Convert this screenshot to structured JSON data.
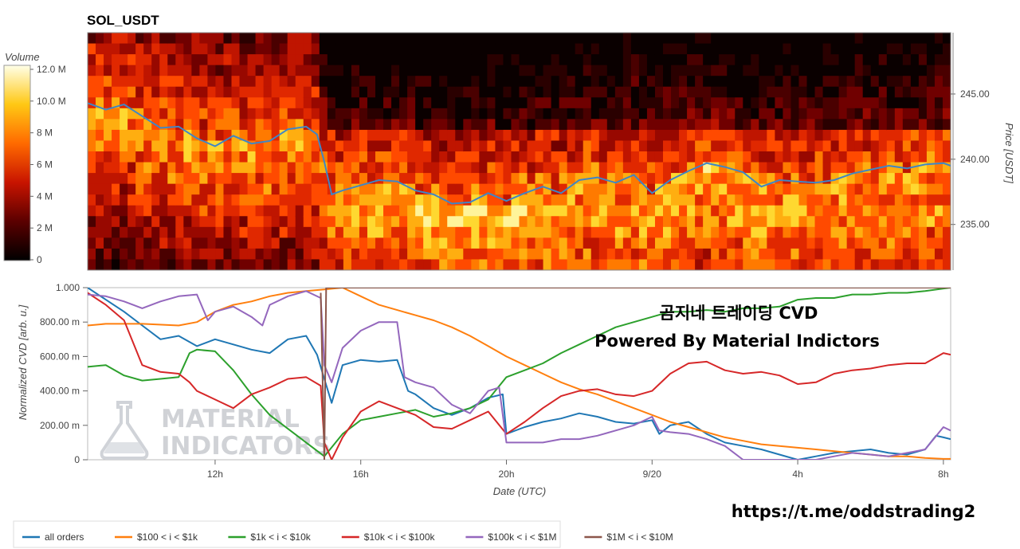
{
  "chart_data": [
    {
      "type": "heatmap",
      "title": "SOL_USDT",
      "colorbar": {
        "label": "Volume",
        "ticks": [
          "0",
          "2 M",
          "4 M",
          "6 M",
          "8 M",
          "10.0 M",
          "12.0 M"
        ],
        "range": [
          0,
          12000000
        ]
      },
      "x_range_hours": [
        8.5,
        32.2
      ],
      "ylabel": "Price [USDT]",
      "y_ticks": [
        "235.00",
        "240.00",
        "245.00"
      ],
      "ylim": [
        231.5,
        249.7
      ],
      "price_line": {
        "x_hours": [
          8.5,
          9.0,
          9.5,
          10.0,
          10.5,
          11.0,
          11.5,
          12.0,
          12.5,
          13.0,
          13.5,
          14.0,
          14.5,
          14.8,
          15.0,
          15.2,
          15.5,
          16.0,
          16.5,
          17.0,
          17.5,
          18.0,
          18.5,
          19.0,
          19.5,
          20.0,
          20.5,
          21.0,
          21.5,
          22.0,
          22.5,
          23.0,
          23.5,
          24.0,
          24.5,
          25.0,
          25.5,
          26.0,
          26.5,
          27.0,
          27.5,
          28.0,
          28.5,
          29.0,
          29.5,
          30.0,
          30.5,
          31.0,
          31.5,
          32.0,
          32.2
        ],
        "price": [
          244.3,
          243.8,
          244.2,
          243.3,
          242.4,
          242.5,
          241.6,
          241.0,
          241.8,
          241.2,
          241.4,
          242.3,
          242.5,
          241.9,
          239.8,
          237.3,
          237.6,
          238.0,
          238.4,
          238.3,
          237.6,
          237.3,
          236.6,
          236.7,
          237.4,
          236.8,
          237.4,
          237.9,
          237.4,
          238.4,
          238.6,
          238.2,
          238.8,
          237.4,
          238.4,
          239.1,
          239.7,
          239.4,
          239.0,
          237.9,
          238.4,
          238.3,
          238.2,
          238.4,
          238.9,
          239.2,
          239.5,
          239.3,
          239.6,
          239.7,
          239.5
        ]
      }
    },
    {
      "type": "line",
      "xlabel": "Date (UTC)",
      "ylabel": "Normalized CVD [arb. u.]",
      "x_ticks": [
        "12h",
        "16h",
        "20h",
        "9/20",
        "4h",
        "8h"
      ],
      "x_tick_hours": [
        12,
        16,
        20,
        24,
        28,
        32
      ],
      "x_range_hours": [
        8.5,
        32.2
      ],
      "y_ticks": [
        "0",
        "200.00 m",
        "400.00 m",
        "600.00 m",
        "800.00 m",
        "1.000"
      ],
      "ylim": [
        0,
        1
      ],
      "series": [
        {
          "name": "all orders",
          "color": "#1f77b4",
          "x": [
            8.5,
            9.0,
            9.5,
            10.0,
            10.5,
            11.0,
            11.5,
            12.0,
            12.5,
            13.0,
            13.5,
            14.0,
            14.5,
            14.8,
            15.0,
            15.2,
            15.5,
            16.0,
            16.5,
            17.0,
            17.3,
            17.5,
            18.0,
            18.5,
            19.0,
            19.5,
            19.9,
            20.0,
            20.5,
            21.0,
            21.5,
            22.0,
            22.5,
            23.0,
            23.5,
            24.0,
            24.2,
            24.5,
            25.0,
            25.5,
            26.0,
            26.5,
            27.0,
            27.5,
            28.0,
            28.5,
            29.0,
            29.5,
            30.0,
            30.5,
            31.0,
            31.5,
            31.8,
            32.0,
            32.2
          ],
          "y": [
            1.0,
            0.93,
            0.86,
            0.78,
            0.7,
            0.72,
            0.66,
            0.7,
            0.67,
            0.64,
            0.62,
            0.7,
            0.72,
            0.61,
            0.47,
            0.33,
            0.55,
            0.58,
            0.57,
            0.58,
            0.4,
            0.38,
            0.3,
            0.26,
            0.3,
            0.36,
            0.38,
            0.15,
            0.19,
            0.22,
            0.24,
            0.27,
            0.25,
            0.22,
            0.21,
            0.23,
            0.15,
            0.2,
            0.22,
            0.15,
            0.1,
            0.08,
            0.06,
            0.03,
            0.0,
            0.02,
            0.04,
            0.05,
            0.06,
            0.04,
            0.03,
            0.06,
            0.14,
            0.13,
            0.12
          ]
        },
        {
          "name": "$100 < i < $1k",
          "color": "#ff7f0e",
          "x": [
            8.5,
            9.0,
            10.0,
            11.0,
            11.5,
            12.0,
            12.5,
            13.0,
            13.5,
            14.0,
            14.5,
            15.0,
            15.5,
            16.0,
            16.5,
            17.0,
            17.5,
            18.0,
            18.5,
            19.0,
            19.5,
            20.0,
            20.5,
            21.0,
            21.5,
            22.0,
            22.5,
            23.0,
            23.5,
            24.0,
            24.5,
            25.0,
            25.5,
            26.0,
            26.5,
            27.0,
            27.5,
            28.0,
            28.5,
            29.0,
            29.5,
            30.0,
            30.5,
            31.0,
            31.5,
            32.0,
            32.2
          ],
          "y": [
            0.78,
            0.79,
            0.79,
            0.78,
            0.8,
            0.86,
            0.9,
            0.92,
            0.95,
            0.97,
            0.98,
            0.99,
            1.0,
            0.95,
            0.9,
            0.87,
            0.84,
            0.81,
            0.77,
            0.72,
            0.66,
            0.6,
            0.55,
            0.5,
            0.45,
            0.41,
            0.38,
            0.34,
            0.3,
            0.26,
            0.22,
            0.19,
            0.16,
            0.13,
            0.11,
            0.09,
            0.08,
            0.07,
            0.06,
            0.05,
            0.04,
            0.03,
            0.02,
            0.02,
            0.01,
            0.005,
            0.005
          ]
        },
        {
          "name": "$1k < i < $10k",
          "color": "#2ca02c",
          "x": [
            8.5,
            9.0,
            9.5,
            10.0,
            10.5,
            11.0,
            11.3,
            11.5,
            12.0,
            12.5,
            13.0,
            13.5,
            14.0,
            14.5,
            15.0,
            15.5,
            16.0,
            16.5,
            17.0,
            17.5,
            18.0,
            18.5,
            19.0,
            19.5,
            20.0,
            20.5,
            21.0,
            21.5,
            22.0,
            22.5,
            23.0,
            23.5,
            24.0,
            24.5,
            25.0,
            25.5,
            26.0,
            26.5,
            27.0,
            27.5,
            28.0,
            28.5,
            29.0,
            29.5,
            30.0,
            30.5,
            31.0,
            31.5,
            32.0,
            32.2
          ],
          "y": [
            0.54,
            0.55,
            0.49,
            0.46,
            0.47,
            0.48,
            0.62,
            0.64,
            0.63,
            0.52,
            0.38,
            0.26,
            0.18,
            0.1,
            0.02,
            0.15,
            0.23,
            0.25,
            0.27,
            0.29,
            0.25,
            0.27,
            0.3,
            0.35,
            0.48,
            0.52,
            0.56,
            0.62,
            0.67,
            0.72,
            0.77,
            0.8,
            0.83,
            0.86,
            0.86,
            0.87,
            0.86,
            0.88,
            0.88,
            0.89,
            0.93,
            0.94,
            0.94,
            0.96,
            0.96,
            0.97,
            0.97,
            0.98,
            0.995,
            1.0
          ]
        },
        {
          "name": "$10k < i < $100k",
          "color": "#d62728",
          "x": [
            8.5,
            9.0,
            9.5,
            10.0,
            10.5,
            11.0,
            11.3,
            11.5,
            12.0,
            12.5,
            13.0,
            13.5,
            14.0,
            14.5,
            14.9,
            15.0,
            15.2,
            15.5,
            16.0,
            16.5,
            17.0,
            17.5,
            18.0,
            18.5,
            19.0,
            19.5,
            20.0,
            20.5,
            21.0,
            21.5,
            22.0,
            22.5,
            23.0,
            23.5,
            24.0,
            24.5,
            25.0,
            25.5,
            26.0,
            26.5,
            27.0,
            27.5,
            28.0,
            28.5,
            29.0,
            29.5,
            30.0,
            30.5,
            31.0,
            31.5,
            32.0,
            32.2
          ],
          "y": [
            0.97,
            0.9,
            0.81,
            0.55,
            0.51,
            0.5,
            0.45,
            0.4,
            0.35,
            0.3,
            0.38,
            0.42,
            0.47,
            0.48,
            0.43,
            0.1,
            0.0,
            0.13,
            0.28,
            0.34,
            0.3,
            0.26,
            0.19,
            0.18,
            0.23,
            0.28,
            0.15,
            0.22,
            0.3,
            0.37,
            0.4,
            0.41,
            0.38,
            0.37,
            0.4,
            0.5,
            0.56,
            0.57,
            0.52,
            0.5,
            0.51,
            0.49,
            0.44,
            0.45,
            0.5,
            0.52,
            0.53,
            0.55,
            0.56,
            0.56,
            0.62,
            0.61
          ]
        },
        {
          "name": "$100k < i < $1M",
          "color": "#9467bd",
          "x": [
            8.5,
            9.0,
            9.5,
            10.0,
            10.5,
            11.0,
            11.5,
            11.8,
            12.0,
            12.5,
            13.0,
            13.3,
            13.5,
            14.0,
            14.5,
            14.9,
            15.0,
            15.2,
            15.5,
            16.0,
            16.5,
            17.0,
            17.2,
            17.5,
            18.0,
            18.5,
            19.0,
            19.5,
            19.8,
            20.0,
            20.5,
            21.0,
            21.5,
            22.0,
            22.5,
            23.0,
            23.5,
            24.0,
            24.2,
            24.5,
            25.0,
            25.5,
            26.0,
            26.5,
            27.0,
            27.5,
            28.0,
            28.5,
            29.0,
            29.5,
            30.0,
            30.5,
            31.0,
            31.5,
            32.0,
            32.2
          ],
          "y": [
            0.96,
            0.95,
            0.92,
            0.88,
            0.92,
            0.95,
            0.96,
            0.81,
            0.86,
            0.89,
            0.83,
            0.78,
            0.9,
            0.95,
            0.98,
            0.94,
            0.55,
            0.45,
            0.65,
            0.75,
            0.8,
            0.8,
            0.48,
            0.45,
            0.42,
            0.32,
            0.27,
            0.4,
            0.42,
            0.1,
            0.1,
            0.1,
            0.12,
            0.12,
            0.14,
            0.17,
            0.2,
            0.25,
            0.17,
            0.16,
            0.15,
            0.12,
            0.08,
            0.0,
            0.0,
            0.0,
            0.0,
            0.0,
            0.02,
            0.04,
            0.03,
            0.02,
            0.04,
            0.06,
            0.19,
            0.17
          ]
        },
        {
          "name": "$1M < i < $10M",
          "color": "#8c564b",
          "x": [
            14.9,
            15.0,
            15.05,
            15.3,
            20.0,
            25.0,
            30.0,
            32.2
          ],
          "y": [
            0.97,
            0.0,
            1.0,
            1.0,
            1.0,
            1.0,
            1.0,
            1.0
          ]
        }
      ]
    }
  ],
  "overlay": {
    "brand_line1": "곰지네 트레이딩 CVD",
    "brand_line2": "Powered By Material Indictors",
    "watermark_line1": "MATERIAL",
    "watermark_line2": "INDICATORS",
    "link": "https://t.me/oddstrading2"
  },
  "icons": {
    "watermark": "flask-icon"
  }
}
